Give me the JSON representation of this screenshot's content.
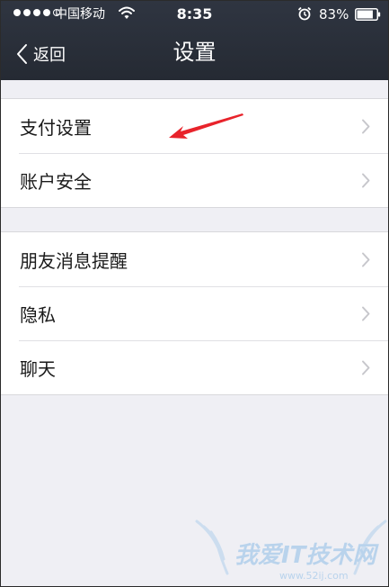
{
  "status_bar": {
    "carrier": "中国移动",
    "time": "8:35",
    "battery_percent": "83%",
    "signal_bars_filled": 4,
    "signal_bars_total": 5,
    "battery_level": 0.83,
    "icons": [
      "wifi-icon",
      "alarm-icon",
      "battery-icon"
    ]
  },
  "nav": {
    "back_label": "返回",
    "title": "设置",
    "background_color": "#2a2f39"
  },
  "groups": [
    {
      "items": [
        {
          "label": "支付设置"
        },
        {
          "label": "账户安全"
        }
      ]
    },
    {
      "items": [
        {
          "label": "朋友消息提醒"
        },
        {
          "label": "隐私"
        },
        {
          "label": "聊天"
        }
      ]
    }
  ],
  "annotation": {
    "type": "red-arrow",
    "color": "#e8232b",
    "points_to": "支付设置"
  },
  "watermark": {
    "text": "我爱IT技术网",
    "url": "www.52ij.com"
  }
}
